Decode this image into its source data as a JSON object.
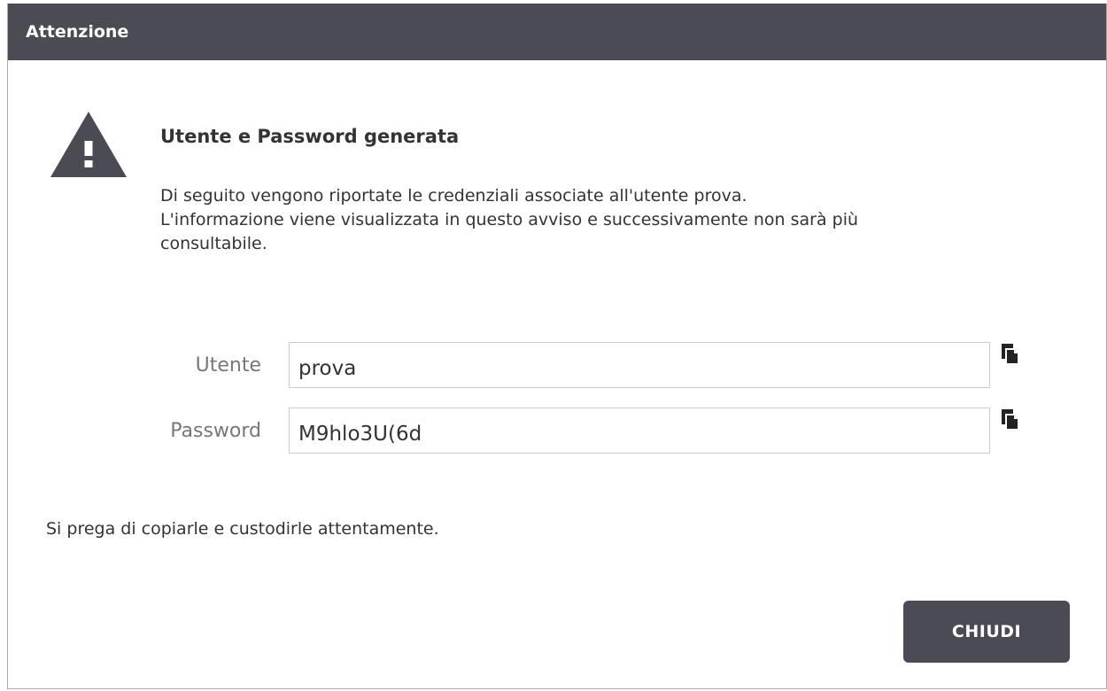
{
  "dialog": {
    "title": "Attenzione",
    "heading": "Utente e Password generata",
    "message_lines": [
      "Di seguito vengono riportate le credenziali associate all'utente prova.",
      "L'informazione viene visualizzata in questo avviso e successivamente non sarà più",
      "consultabile."
    ],
    "fields": {
      "user": {
        "label": "Utente",
        "value": "prova"
      },
      "password": {
        "label": "Password",
        "value": "M9hlo3U(6d"
      }
    },
    "notice": "Si prega di copiarle e custodirle attentamente.",
    "close_label": "CHIUDI"
  },
  "icons": {
    "warning": "warning-triangle-icon",
    "copy": "copy-icon"
  },
  "colors": {
    "titlebar": "#4a4b53",
    "button": "#4a4b53",
    "text": "#333333",
    "label": "#777777",
    "border": "#cccccc"
  }
}
